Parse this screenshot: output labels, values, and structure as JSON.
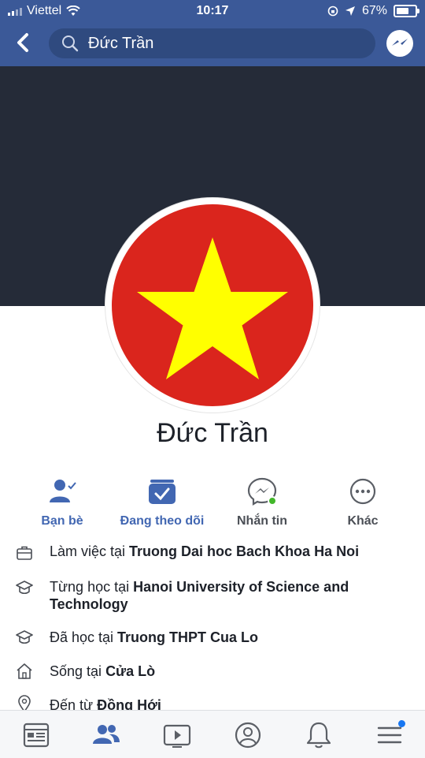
{
  "status_bar": {
    "carrier": "Viettel",
    "time": "10:17",
    "battery_percent": "67%",
    "battery_level": 0.67
  },
  "header": {
    "search_value": "Đức Trần",
    "back_icon": "chevron-left-icon",
    "messenger_icon": "messenger-icon"
  },
  "profile": {
    "name": "Đức Trần",
    "avatar_colors": {
      "background": "#da251d",
      "star": "#ffff00"
    }
  },
  "actions": [
    {
      "label": "Bạn bè",
      "icon": "friends-check-icon"
    },
    {
      "label": "Đang theo dõi",
      "icon": "following-check-icon"
    },
    {
      "label": "Nhắn tin",
      "icon": "messenger-icon"
    },
    {
      "label": "Khác",
      "icon": "more-icon"
    }
  ],
  "info": [
    {
      "prefix": "Làm việc tại ",
      "value": "Truong Dai hoc Bach Khoa Ha Noi",
      "icon": "briefcase-icon"
    },
    {
      "prefix": "Từng học tại ",
      "value": "Hanoi University of Science and Technology",
      "icon": "graduation-cap-icon"
    },
    {
      "prefix": "Đã học tại ",
      "value": "Truong THPT Cua Lo",
      "icon": "graduation-cap-icon"
    },
    {
      "prefix": "Sống tại ",
      "value": "Cửa Lò",
      "icon": "home-icon"
    },
    {
      "prefix": "Đến từ ",
      "value": "Đồng Hới",
      "icon": "location-pin-icon"
    }
  ],
  "tabbar": {
    "tabs": [
      "news-feed-icon",
      "friends-icon",
      "watch-icon",
      "profile-icon",
      "notifications-icon",
      "menu-icon"
    ],
    "active_color": "#4267b2",
    "inactive_color": "#5b5f66"
  }
}
